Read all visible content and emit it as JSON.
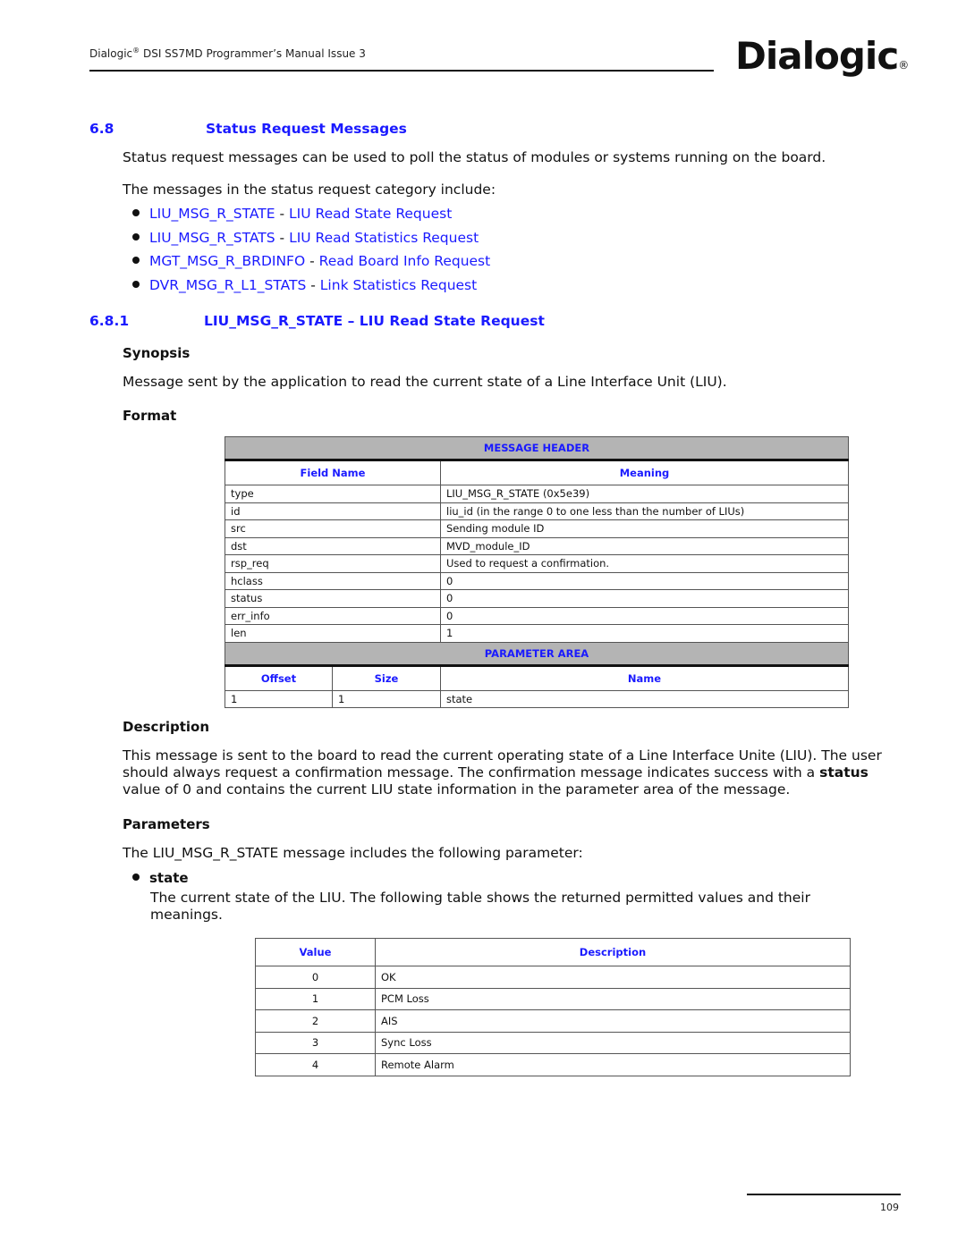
{
  "header": {
    "running_head_prefix": "Dialogic",
    "running_head_reg": "®",
    "running_head_rest": " DSI SS7MD Programmer’s Manual  Issue 3",
    "logo_text": "Dialogic",
    "logo_reg": "®"
  },
  "section": {
    "number": "6.8",
    "title": "Status Request Messages",
    "intro": "Status request messages can be used to poll the status of modules or systems running on the board.",
    "list_intro": "The messages in the status request category include:",
    "links": [
      {
        "code": "LIU_MSG_R_STATE",
        "sep": " - ",
        "label": "LIU Read State Request"
      },
      {
        "code": "LIU_MSG_R_STATS",
        "sep": " - ",
        "label": "LIU Read Statistics Request"
      },
      {
        "code": "MGT_MSG_R_BRDINFO",
        "sep": " - ",
        "label": "Read Board Info Request"
      },
      {
        "code": "DVR_MSG_R_L1_STATS",
        "sep": " - ",
        "label": "Link Statistics Request"
      }
    ]
  },
  "subsection": {
    "number": "6.8.1",
    "title": "LIU_MSG_R_STATE – LIU Read State Request",
    "synopsis_heading": "Synopsis",
    "synopsis": "Message sent by the application to read the current state of a Line Interface Unit (LIU).",
    "format_heading": "Format",
    "description_heading": "Description",
    "description_1": "This message is sent to the board to read the current operating state of a Line Interface Unite (LIU). The user should always request a confirmation message. The confirmation message indicates success with a ",
    "description_bold": "status",
    "description_2": " value of 0 and contains the current LIU state information in the parameter area of the message.",
    "parameters_heading": "Parameters",
    "parameters_intro": "The LIU_MSG_R_STATE message includes the following parameter:",
    "param_name": "state",
    "param_desc": "The current state of the LIU. The following table shows the returned permitted values and their meanings."
  },
  "format_table": {
    "header_band": "MESSAGE HEADER",
    "columns": [
      "Field Name",
      "Meaning"
    ],
    "rows": [
      [
        "type",
        "LIU_MSG_R_STATE (0x5e39)"
      ],
      [
        "id",
        "liu_id (in the range 0 to one less than the number of LIUs)"
      ],
      [
        "src",
        "Sending module ID"
      ],
      [
        "dst",
        "MVD_module_ID"
      ],
      [
        "rsp_req",
        "Used to request a confirmation."
      ],
      [
        "hclass",
        "0"
      ],
      [
        "status",
        "0"
      ],
      [
        "err_info",
        "0"
      ],
      [
        "len",
        "1"
      ]
    ],
    "param_band": "PARAMETER AREA",
    "param_columns": [
      "Offset",
      "Size",
      "Name"
    ],
    "param_rows": [
      [
        "1",
        "1",
        "state"
      ]
    ]
  },
  "value_table": {
    "columns": [
      "Value",
      "Description"
    ],
    "rows": [
      [
        "0",
        "OK"
      ],
      [
        "1",
        "PCM Loss"
      ],
      [
        "2",
        "AIS"
      ],
      [
        "3",
        "Sync Loss"
      ],
      [
        "4",
        "Remote Alarm"
      ]
    ]
  },
  "footer": {
    "page_number": "109"
  }
}
